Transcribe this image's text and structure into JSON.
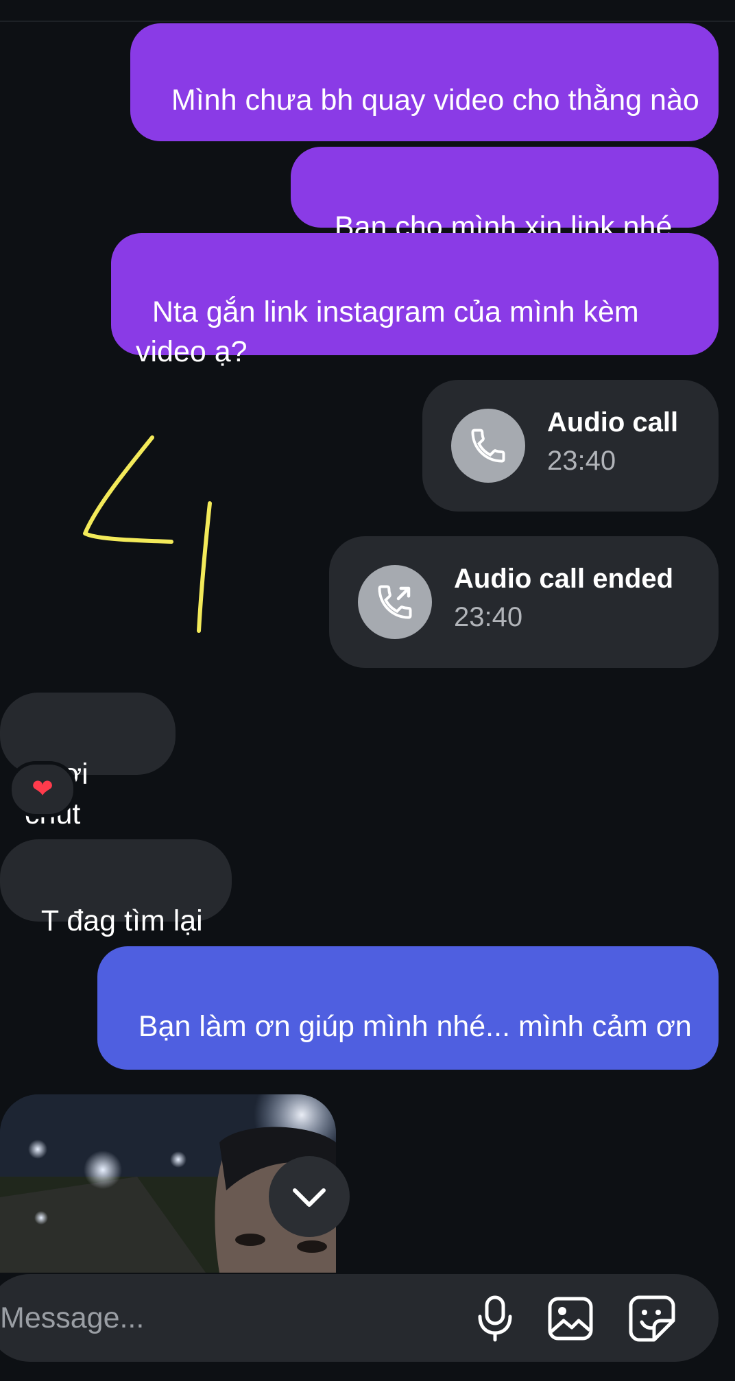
{
  "messages": [
    {
      "text": "Mình chưa bh quay video cho thằng nào"
    },
    {
      "text": "Bạn cho mình xin link nhé"
    },
    {
      "text": "Nta gắn link instagram của mình kèm video ạ?"
    },
    {
      "text": "Đợi chút"
    },
    {
      "text": "T đag tìm lại"
    },
    {
      "text": "Bạn làm ơn giúp mình nhé... mình cảm ơn"
    }
  ],
  "calls": [
    {
      "title": "Audio call",
      "time": "23:40"
    },
    {
      "title": "Audio call ended",
      "time": "23:40"
    }
  ],
  "reaction": {
    "emoji": "❤"
  },
  "composer": {
    "placeholder": "Message..."
  },
  "icons": [
    "phone-icon",
    "outgoing-call-icon",
    "heart-icon",
    "chevron-down-icon",
    "microphone-icon",
    "image-icon",
    "sticker-icon"
  ],
  "colors": {
    "outgoing": "#8a3be6",
    "outgoing_alt": "#4f5fe0",
    "incoming": "#26292e",
    "background": "#0d1014",
    "annotation": "#f3ea5a"
  }
}
